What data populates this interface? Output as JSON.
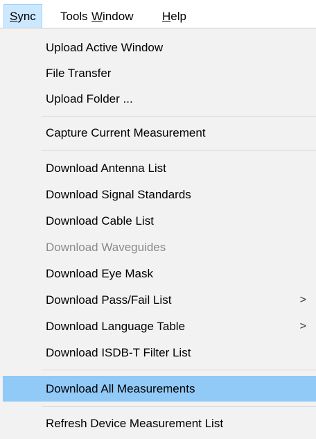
{
  "menubar": {
    "items": [
      {
        "label": "Sync",
        "mnemonic": "S",
        "rest": "ync"
      },
      {
        "label": "Tools"
      },
      {
        "label": "Window",
        "mnemonic": "W",
        "rest": "indow"
      },
      {
        "label": "Help",
        "mnemonic": "H",
        "rest": "elp"
      }
    ]
  },
  "menu": {
    "items": [
      {
        "label": "Upload Active Window"
      },
      {
        "label": "File Transfer"
      },
      {
        "label": "Upload Folder ..."
      },
      {
        "label": "Capture Current Measurement"
      },
      {
        "label": "Download Antenna List"
      },
      {
        "label": "Download Signal Standards"
      },
      {
        "label": "Download Cable List"
      },
      {
        "label": "Download Waveguides",
        "disabled": true
      },
      {
        "label": "Download Eye Mask"
      },
      {
        "label": "Download Pass/Fail List",
        "submenu_arrow": ">"
      },
      {
        "label": "Download Language Table",
        "submenu_arrow": ">"
      },
      {
        "label": "Download ISDB-T Filter List"
      },
      {
        "label": "Download All Measurements",
        "highlighted": true
      },
      {
        "label": "Refresh Device Measurement List"
      }
    ]
  },
  "colors": {
    "menu_bg": "#f2f2f2",
    "highlight": "#91c9f7",
    "disabled_text": "#8a8a8a"
  }
}
